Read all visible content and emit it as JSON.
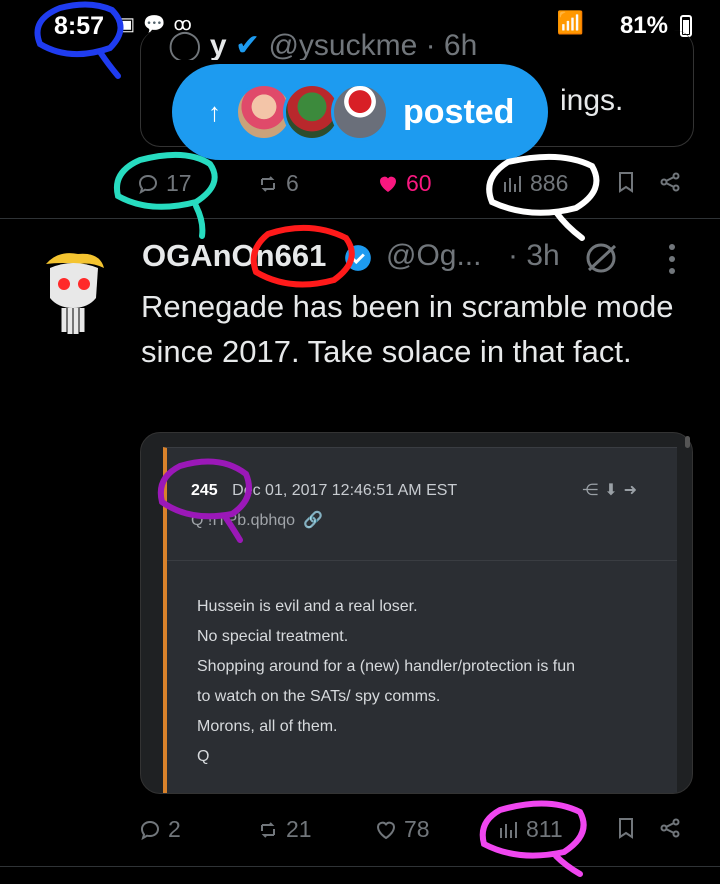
{
  "status": {
    "time": "8:57",
    "battery": "81%"
  },
  "prev_tweet": {
    "header_name": "y",
    "header_handle": "@ysuckme · 6h",
    "text_fragment": "ings.",
    "replies": "17",
    "reposts": "6",
    "likes": "60",
    "views": "886"
  },
  "posted_pill": {
    "label": "posted"
  },
  "tweet": {
    "name": "OGAnOn661",
    "handle": "@Og...",
    "time": "· 3h",
    "text": "Renegade has been in scramble mode since 2017. Take solace in that fact.",
    "replies": "2",
    "reposts": "21",
    "likes": "78",
    "views": "811"
  },
  "embedded_post": {
    "number": "245",
    "date": "Dec 01, 2017 12:46:51 AM EST",
    "author": "Q !ITPb.qbhqo",
    "lines": [
      "Hussein is evil and a real loser.",
      "No special treatment.",
      "Shopping around for a (new) handler/protection is fun",
      "to watch on the SATs/ spy comms.",
      "Morons, all of them.",
      "Q"
    ]
  },
  "colors": {
    "accent_blue": "#1d9bf0",
    "like_pink": "#f91880",
    "mark_blue": "#1f3cf0",
    "mark_teal": "#27dcc0",
    "mark_red": "#ff1a1a",
    "mark_white": "#ffffff",
    "mark_purple": "#9b18b8",
    "mark_magenta": "#f046f0"
  }
}
